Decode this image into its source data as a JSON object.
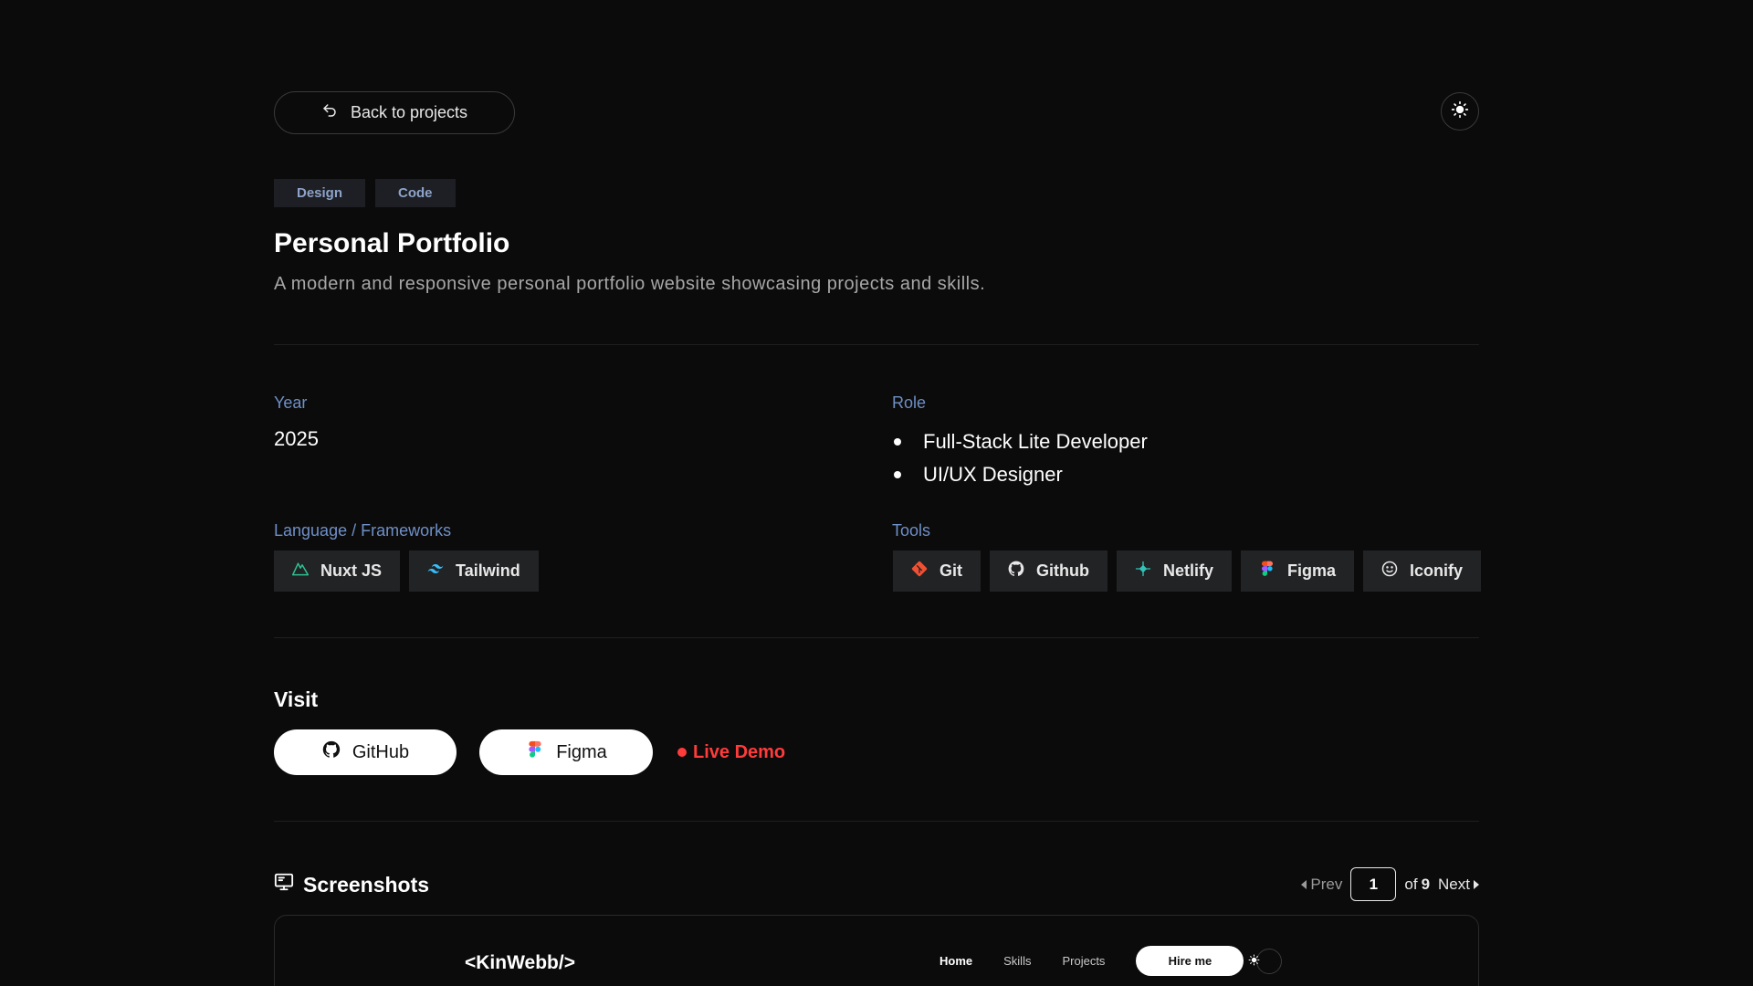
{
  "topbar": {
    "back_label": "Back to projects"
  },
  "tags": [
    "Design",
    "Code"
  ],
  "project": {
    "title": "Personal Portfolio",
    "description": "A modern and responsive personal portfolio website showcasing projects and skills."
  },
  "details": {
    "year_label": "Year",
    "year": "2025",
    "role_label": "Role",
    "roles": [
      "Full-Stack Lite Developer",
      "UI/UX Designer"
    ],
    "frameworks_label": "Language / Frameworks",
    "frameworks": [
      {
        "name": "Nuxt JS",
        "icon": "nuxt-icon"
      },
      {
        "name": "Tailwind",
        "icon": "tailwind-icon"
      }
    ],
    "tools_label": "Tools",
    "tools": [
      {
        "name": "Git",
        "icon": "git-icon"
      },
      {
        "name": "Github",
        "icon": "github-icon"
      },
      {
        "name": "Netlify",
        "icon": "netlify-icon"
      },
      {
        "name": "Figma",
        "icon": "figma-icon"
      },
      {
        "name": "Iconify",
        "icon": "iconify-icon"
      }
    ]
  },
  "visit": {
    "title": "Visit",
    "github_label": "GitHub",
    "figma_label": "Figma",
    "live_label": "Live Demo"
  },
  "screenshots": {
    "title": "Screenshots",
    "prev_label": "Prev",
    "next_label": "Next",
    "page": "1",
    "of_label": "of",
    "total": "9"
  },
  "preview": {
    "logo": "<KinWebb/>",
    "nav": [
      "Home",
      "Skills",
      "Projects"
    ],
    "hire_label": "Hire me"
  },
  "colors": {
    "background": "#0b0b0b",
    "accent_label": "#6f8fc6",
    "live": "#ff3b3b"
  }
}
